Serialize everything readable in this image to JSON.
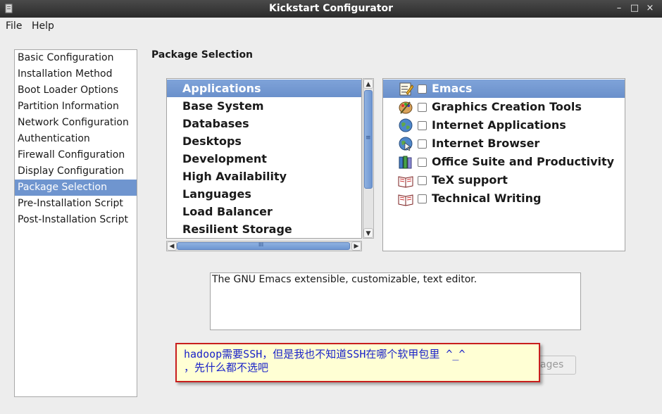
{
  "window": {
    "title": "Kickstart Configurator",
    "controls": {
      "minimize": "–",
      "maximize": "□",
      "close": "×"
    }
  },
  "menubar": {
    "items": [
      "File",
      "Help"
    ]
  },
  "sidebar": {
    "selected": "Package Selection",
    "items": [
      "Basic Configuration",
      "Installation Method",
      "Boot Loader Options",
      "Partition Information",
      "Network Configuration",
      "Authentication",
      "Firewall Configuration",
      "Display Configuration",
      "Package Selection",
      "Pre-Installation Script",
      "Post-Installation Script"
    ]
  },
  "main": {
    "section_title": "Package Selection",
    "groups": {
      "selected": "Applications",
      "items": [
        "Applications",
        "Base System",
        "Databases",
        "Desktops",
        "Development",
        "High Availability",
        "Languages",
        "Load Balancer",
        "Resilient Storage"
      ]
    },
    "scrollbars": {
      "vertical_grip": "≡",
      "horizontal_grip": "III",
      "arrow_up": "▲",
      "arrow_down": "▼",
      "arrow_left": "◀",
      "arrow_right": "▶"
    },
    "packages": {
      "selected": "Emacs",
      "items": [
        {
          "label": "Emacs",
          "icon": "text-editor-icon",
          "checked": false
        },
        {
          "label": "Graphics Creation Tools",
          "icon": "paint-palette-icon",
          "checked": false
        },
        {
          "label": "Internet Applications",
          "icon": "globe-icon",
          "checked": false
        },
        {
          "label": "Internet Browser",
          "icon": "globe-browser-icon",
          "checked": false
        },
        {
          "label": "Office Suite and Productivity",
          "icon": "office-binders-icon",
          "checked": false
        },
        {
          "label": "TeX support",
          "icon": "book-icon",
          "checked": false
        },
        {
          "label": "Technical Writing",
          "icon": "book-icon",
          "checked": false
        }
      ]
    },
    "description": "The GNU Emacs extensible, customizable, text editor.",
    "packages_button_visible_text": "kages"
  },
  "annotation": {
    "text": "hadoop需要SSH，但是我也不知道SSH在哪个软甲包里 ^_^\n，先什么都不选吧",
    "text_color": "#1a22c8",
    "border_color": "#c81e1e",
    "background": "#ffffd4"
  },
  "colors": {
    "selection": "#6f95cf",
    "window_bg": "#ededed",
    "titlebar": "#2b2b2b"
  }
}
